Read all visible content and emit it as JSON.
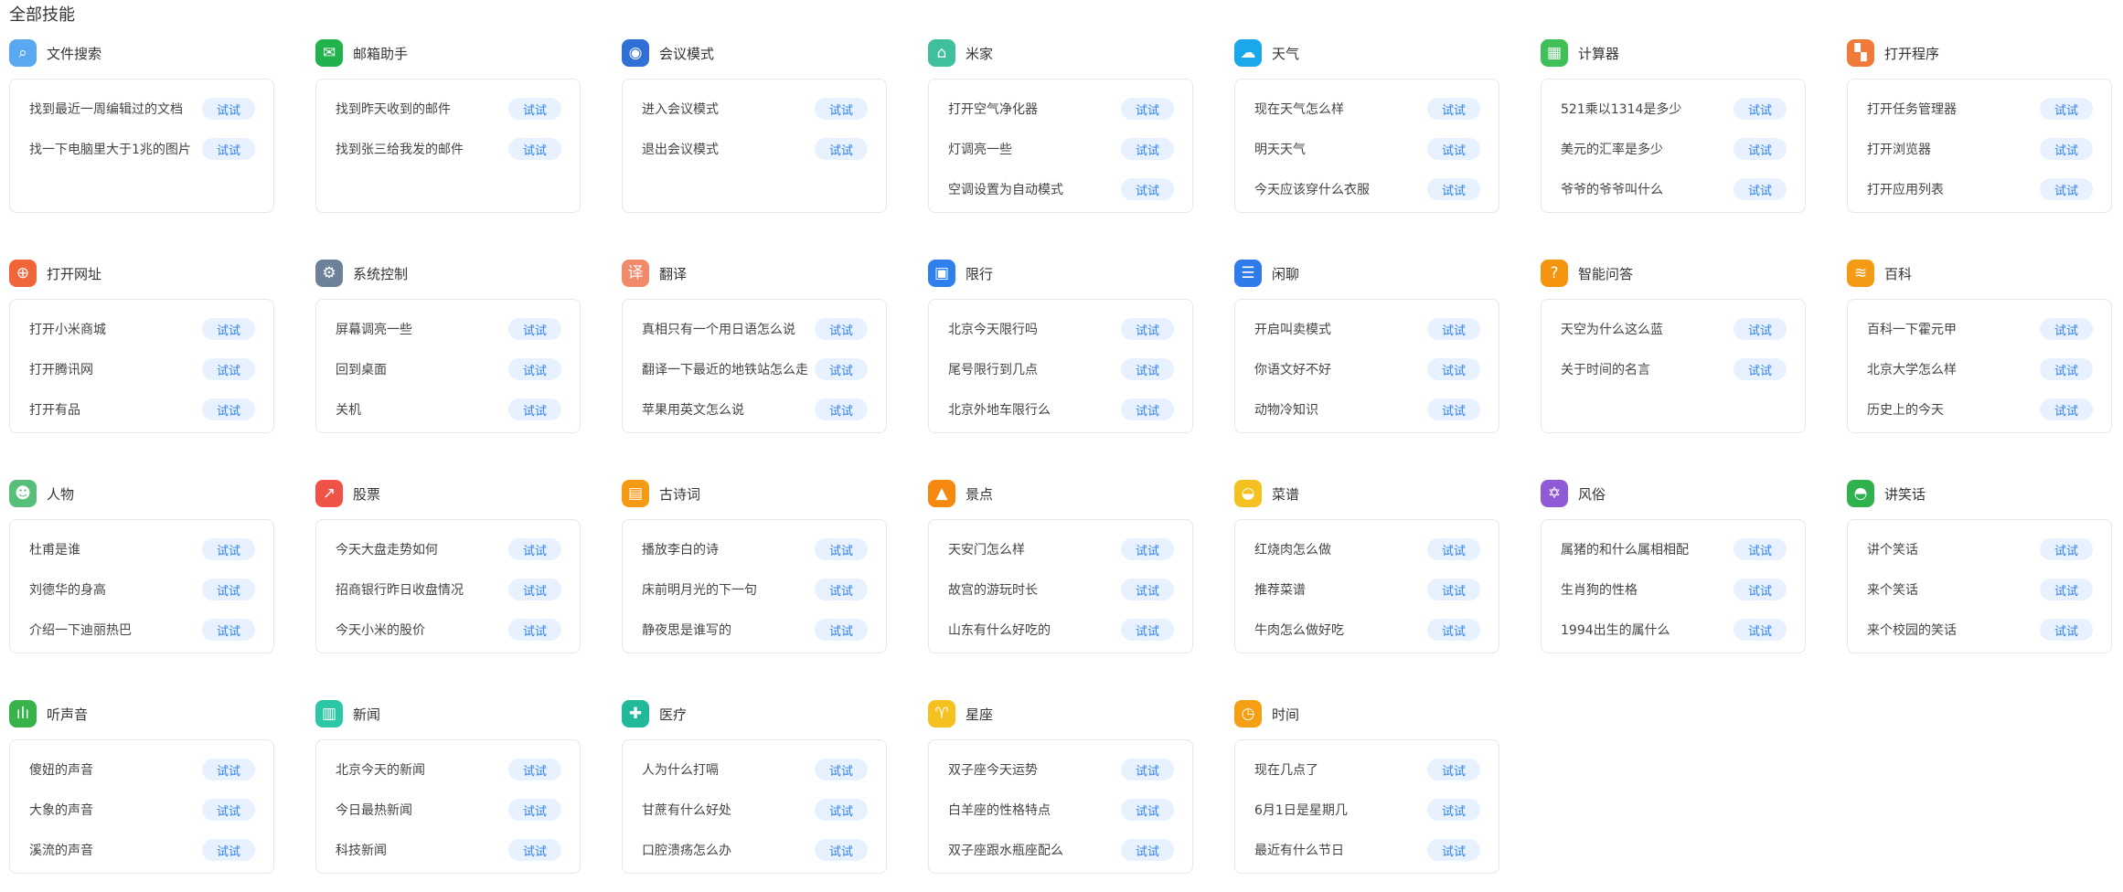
{
  "page_title": "全部技能",
  "try_label": "试试",
  "skills": [
    {
      "name": "文件搜索",
      "icon": "file-search-icon",
      "glyph": "⌕",
      "color": "#5aa8f0",
      "examples": [
        "找到最近一周编辑过的文档",
        "找一下电脑里大于1兆的图片"
      ]
    },
    {
      "name": "邮箱助手",
      "icon": "mail-icon",
      "glyph": "✉",
      "color": "#21b24d",
      "examples": [
        "找到昨天收到的邮件",
        "找到张三给我发的邮件"
      ]
    },
    {
      "name": "会议模式",
      "icon": "meeting-user-icon",
      "glyph": "◉",
      "color": "#2f6fd6",
      "examples": [
        "进入会议模式",
        "退出会议模式"
      ]
    },
    {
      "name": "米家",
      "icon": "mijia-home-icon",
      "glyph": "⌂",
      "color": "#3fbf9c",
      "examples": [
        "打开空气净化器",
        "灯调亮一些",
        "空调设置为自动模式"
      ]
    },
    {
      "name": "天气",
      "icon": "weather-icon",
      "glyph": "☁",
      "color": "#1aa7ec",
      "examples": [
        "现在天气怎么样",
        "明天天气",
        "今天应该穿什么衣服"
      ]
    },
    {
      "name": "计算器",
      "icon": "calculator-icon",
      "glyph": "▦",
      "color": "#41c05a",
      "examples": [
        "521乘以1314是多少",
        "美元的汇率是多少",
        "爷爷的爷爷叫什么"
      ]
    },
    {
      "name": "打开程序",
      "icon": "apps-icon",
      "glyph": "▚",
      "color": "#f07a3a",
      "examples": [
        "打开任务管理器",
        "打开浏览器",
        "打开应用列表"
      ]
    },
    {
      "name": "打开网址",
      "icon": "globe-icon",
      "glyph": "⊕",
      "color": "#f0663a",
      "examples": [
        "打开小米商城",
        "打开腾讯网",
        "打开有品"
      ]
    },
    {
      "name": "系统控制",
      "icon": "gear-icon",
      "glyph": "⚙",
      "color": "#6d8298",
      "examples": [
        "屏幕调亮一些",
        "回到桌面",
        "关机"
      ]
    },
    {
      "name": "翻译",
      "icon": "translate-icon",
      "glyph": "译",
      "color": "#f08a6a",
      "examples": [
        "真相只有一个用日语怎么说",
        "翻译一下最近的地铁站怎么走",
        "苹果用英文怎么说"
      ]
    },
    {
      "name": "限行",
      "icon": "car-icon",
      "glyph": "▣",
      "color": "#2f80ed",
      "examples": [
        "北京今天限行吗",
        "尾号限行到几点",
        "北京外地车限行么"
      ]
    },
    {
      "name": "闲聊",
      "icon": "chat-icon",
      "glyph": "☰",
      "color": "#2f7bec",
      "examples": [
        "开启叫卖模式",
        "你语文好不好",
        "动物冷知识"
      ]
    },
    {
      "name": "智能问答",
      "icon": "qa-icon",
      "glyph": "?",
      "color": "#f5940f",
      "examples": [
        "天空为什么这么蓝",
        "关于时间的名言"
      ]
    },
    {
      "name": "百科",
      "icon": "encyclopedia-icon",
      "glyph": "≋",
      "color": "#f59a14",
      "examples": [
        "百科一下霍元甲",
        "北京大学怎么样",
        "历史上的今天"
      ]
    },
    {
      "name": "人物",
      "icon": "person-icon",
      "glyph": "☻",
      "color": "#58bf7a",
      "examples": [
        "杜甫是谁",
        "刘德华的身高",
        "介绍一下迪丽热巴"
      ]
    },
    {
      "name": "股票",
      "icon": "stock-chart-icon",
      "glyph": "↗",
      "color": "#f0524a",
      "examples": [
        "今天大盘走势如何",
        "招商银行昨日收盘情况",
        "今天小米的股价"
      ]
    },
    {
      "name": "古诗词",
      "icon": "poem-icon",
      "glyph": "▤",
      "color": "#f59a14",
      "examples": [
        "播放李白的诗",
        "床前明月光的下一句",
        "静夜思是谁写的"
      ]
    },
    {
      "name": "景点",
      "icon": "landmark-icon",
      "glyph": "▲",
      "color": "#f5890f",
      "examples": [
        "天安门怎么样",
        "故宫的游玩时长",
        "山东有什么好吃的"
      ]
    },
    {
      "name": "菜谱",
      "icon": "recipe-icon",
      "glyph": "◒",
      "color": "#f5c120",
      "examples": [
        "红烧肉怎么做",
        "推荐菜谱",
        "牛肉怎么做好吃"
      ]
    },
    {
      "name": "风俗",
      "icon": "custom-star-icon",
      "glyph": "✡",
      "color": "#8f5ad8",
      "examples": [
        "属猪的和什么属相相配",
        "生肖狗的性格",
        "1994出生的属什么"
      ]
    },
    {
      "name": "讲笑话",
      "icon": "joke-icon",
      "glyph": "◓",
      "color": "#2fb24d",
      "examples": [
        "讲个笑话",
        "来个笑话",
        "来个校园的笑话"
      ]
    },
    {
      "name": "听声音",
      "icon": "sound-wave-icon",
      "glyph": "ılı",
      "color": "#37b34a",
      "examples": [
        "傻妞的声音",
        "大象的声音",
        "溪流的声音"
      ]
    },
    {
      "name": "新闻",
      "icon": "news-icon",
      "glyph": "▥",
      "color": "#2ec7a6",
      "examples": [
        "北京今天的新闻",
        "今日最热新闻",
        "科技新闻"
      ]
    },
    {
      "name": "医疗",
      "icon": "medical-shield-icon",
      "glyph": "✚",
      "color": "#21b99a",
      "examples": [
        "人为什么打嗝",
        "甘蔗有什么好处",
        "口腔溃疡怎么办"
      ]
    },
    {
      "name": "星座",
      "icon": "zodiac-icon",
      "glyph": "♈",
      "color": "#f5c120",
      "examples": [
        "双子座今天运势",
        "白羊座的性格特点",
        "双子座跟水瓶座配么"
      ]
    },
    {
      "name": "时间",
      "icon": "clock-icon",
      "glyph": "◷",
      "color": "#f5a014",
      "examples": [
        "现在几点了",
        "6月1日是星期几",
        "最近有什么节日"
      ]
    }
  ]
}
